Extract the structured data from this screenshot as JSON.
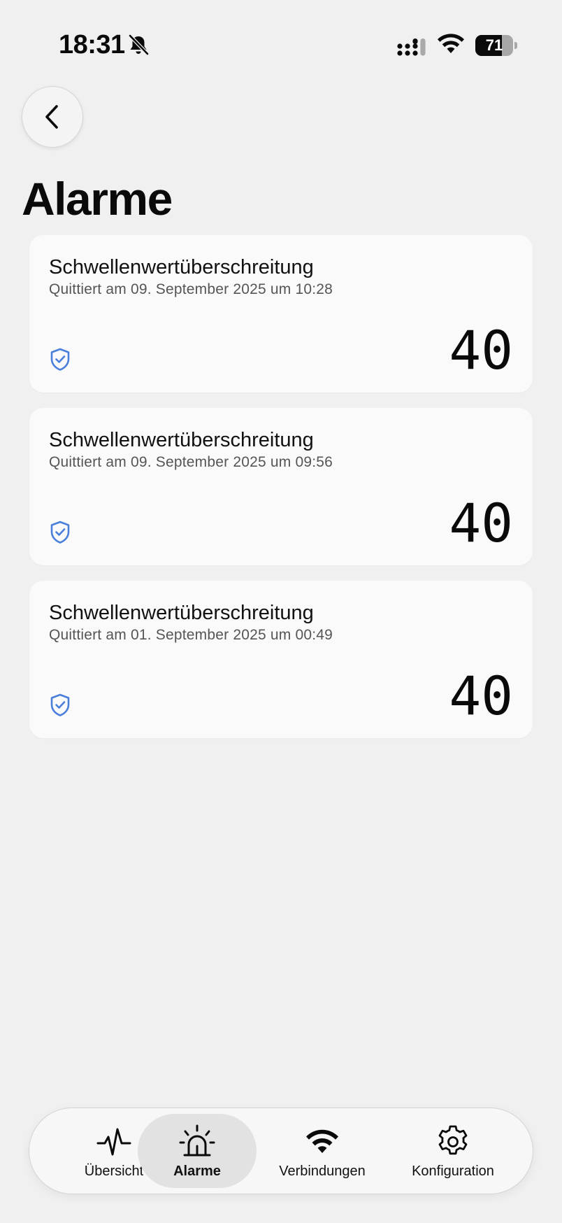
{
  "status_bar": {
    "time": "18:31",
    "battery_level": "71",
    "battery_fraction": 0.71
  },
  "header": {
    "title": "Alarme"
  },
  "alarms": [
    {
      "title": "Schwellenwertüberschreitung",
      "subtitle": "Quittiert am 09. September 2025 um 10:28",
      "value": "40",
      "status_icon": "shield-check-icon"
    },
    {
      "title": "Schwellenwertüberschreitung",
      "subtitle": "Quittiert am 09. September 2025 um 09:56",
      "value": "40",
      "status_icon": "shield-check-icon"
    },
    {
      "title": "Schwellenwertüberschreitung",
      "subtitle": "Quittiert am 01. September 2025 um 00:49",
      "value": "40",
      "status_icon": "shield-check-icon"
    }
  ],
  "tab_bar": {
    "tabs": [
      {
        "label": "Übersicht",
        "icon": "pulse-icon",
        "active": false
      },
      {
        "label": "Alarme",
        "icon": "siren-icon",
        "active": true
      },
      {
        "label": "Verbindungen",
        "icon": "wifi-icon",
        "active": false
      },
      {
        "label": "Konfiguration",
        "icon": "gear-icon",
        "active": false
      }
    ]
  },
  "colors": {
    "background": "#f0f0f0",
    "card": "#fafafa",
    "accent_blue": "#4a7fdc",
    "active_tab": "#e2e2e2"
  }
}
